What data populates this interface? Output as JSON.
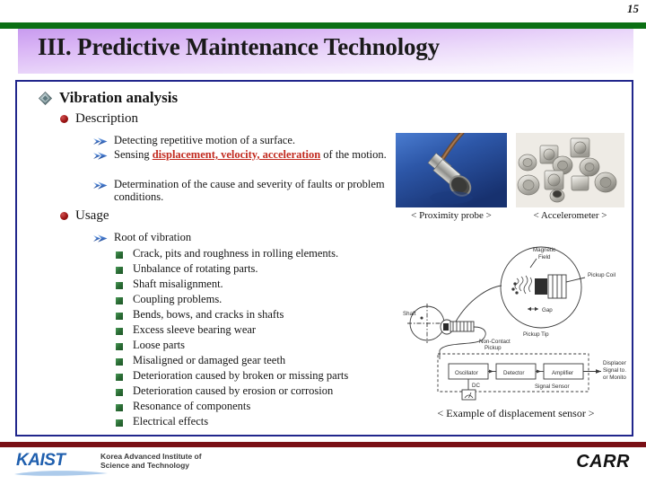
{
  "slide": {
    "page_number": "15",
    "title": "III. Predictive Maintenance Technology",
    "accent_green": "#0b7014",
    "accent_navy": "#21268c",
    "accent_maroon": "#7a1016",
    "title_band_color": "#c89bef"
  },
  "content": {
    "heading": "Vibration analysis",
    "description": {
      "label": "Description",
      "items": [
        {
          "pre": "Detecting repetitive motion of a surface.",
          "highlight": "",
          "post": ""
        },
        {
          "pre": "Sensing ",
          "highlight": "displacement, velocity, acceleration",
          "post": " of the motion."
        },
        {
          "pre": "Determination of the cause and severity of faults or problem conditions.",
          "highlight": "",
          "post": ""
        }
      ]
    },
    "usage": {
      "label": "Usage",
      "subheading": "Root of vibration",
      "items": [
        "Crack, pits and roughness in rolling elements.",
        "Unbalance of rotating parts.",
        "Shaft misalignment.",
        "Coupling problems.",
        "Bends, bows, and cracks in shafts",
        "Excess sleeve bearing wear",
        "Loose parts",
        "Misaligned or damaged gear teeth",
        "Deterioration caused by broken or missing parts",
        "Deterioration caused by erosion or corrosion",
        "Resonance of components",
        "Electrical effects"
      ]
    }
  },
  "figures": {
    "proximity_caption": "< Proximity probe >",
    "accelerometer_caption": "< Accelerometer >",
    "diagram_caption": "< Example of displacement sensor >",
    "diagram_labels": {
      "magnetic_field": "Magnetic Field",
      "pickup_coil": "Pickup Coil",
      "gap": "Gap",
      "pickup_tip": "Pickup Tip",
      "shaft": "Shaft",
      "non_contact_pickup": "Non-Contact Pickup",
      "oscillator": "Oscillator",
      "detector": "Detector",
      "amplifier": "Amplifier",
      "signal_sensor": "Signal Sensor",
      "dc": "DC",
      "gap_meter": "Gap Meter",
      "output": "Displacement Signal to Analyzer or Monitor"
    }
  },
  "footer": {
    "kaist_wordmark": "KAIST",
    "kaist_subtitle": "Korea Advanced Institute of\nScience and Technology",
    "carr_wordmark": "CARR"
  }
}
